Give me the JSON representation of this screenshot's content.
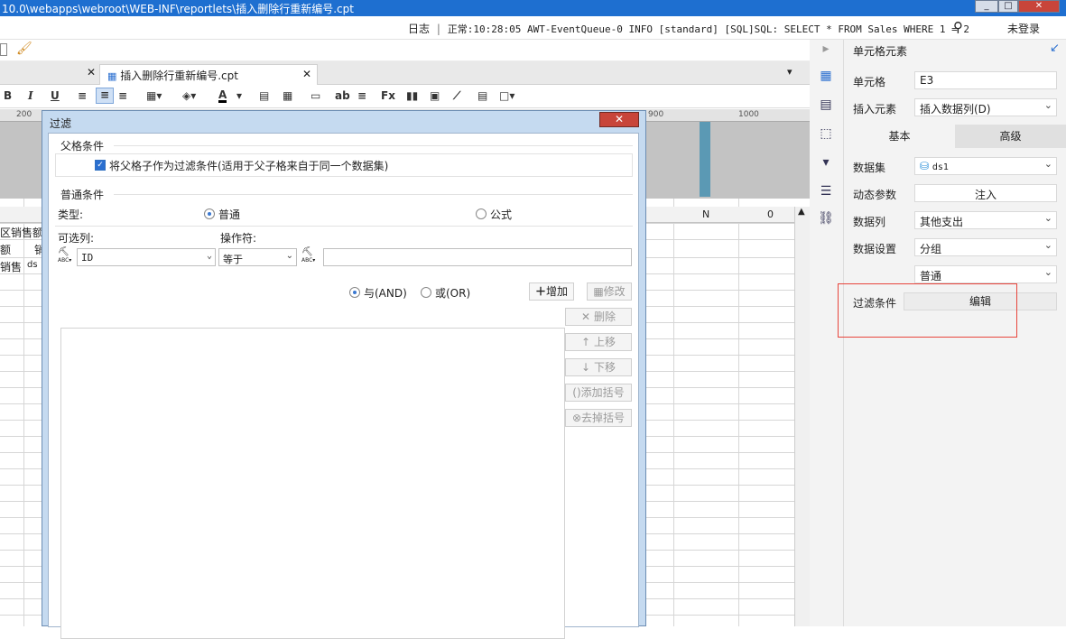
{
  "titlebar": {
    "path": "10.0\\webapps\\webroot\\WEB-INF\\reportlets\\插入删除行重新编号.cpt"
  },
  "logbar": {
    "log_label": "日志",
    "separator": "|",
    "message": "正常:10:28:05 AWT-EventQueue-0 INFO [standard] [SQL]SQL: SELECT * FROM Sales WHERE 1 = 2",
    "login": "未登录"
  },
  "tabs": [
    {
      "label": "插入删除行重新编号.cpt"
    }
  ],
  "ruler": {
    "left": "200",
    "mid": "900",
    "right": "1000"
  },
  "sheet": {
    "col_n": "N",
    "col_o": "0",
    "cell_a1": "区销售额",
    "cell_a2": "额",
    "cell_b2": "销",
    "cell_a3": "销售",
    "cell_b3": "ds"
  },
  "panel": {
    "title": "单元格元素",
    "cell_label": "单元格",
    "cell_value": "E3",
    "insert_label": "插入元素",
    "insert_value": "插入数据列(D)",
    "tab_basic": "基本",
    "tab_advanced": "高级",
    "dataset_label": "数据集",
    "dataset_value": "ds1",
    "dynparam_label": "动态参数",
    "dynparam_button": "注入",
    "column_label": "数据列",
    "column_value": "其他支出",
    "setting_label": "数据设置",
    "setting_value": "分组",
    "mode_value": "普通",
    "filter_label": "过滤条件",
    "filter_button": "编辑"
  },
  "dialog": {
    "title": "过滤",
    "parent_section": "父格条件",
    "parent_checkbox": "将父格子作为过滤条件(适用于父子格来自于同一个数据集)",
    "normal_section": "普通条件",
    "type_label": "类型:",
    "type_normal": "普通",
    "type_formula": "公式",
    "column_label": "可选列:",
    "operator_label": "操作符:",
    "column_value": "ID",
    "operator_value": "等于",
    "value_field": "",
    "and_label": "与(AND)",
    "or_label": "或(OR)",
    "add_button": "增加",
    "modify_button": "修改",
    "delete_button": "删除",
    "up_button": "上移",
    "down_button": "下移",
    "add_bracket_button": "添加括号",
    "remove_bracket_button": "去掉括号"
  }
}
